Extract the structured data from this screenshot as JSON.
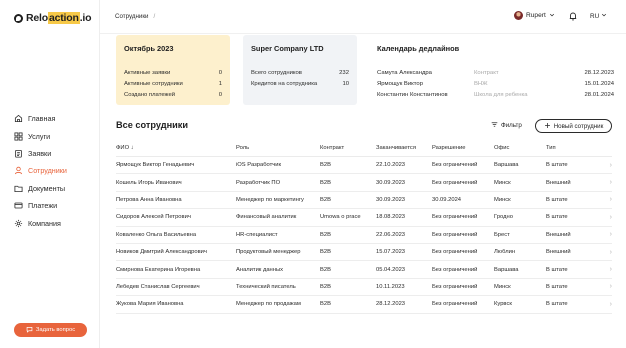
{
  "app": {
    "logo_prefix": "Relo",
    "logo_highlight": "action",
    "logo_suffix": ".io"
  },
  "sidebar": {
    "items": [
      {
        "label": "Главная",
        "icon": "home-icon",
        "active": false
      },
      {
        "label": "Услуги",
        "icon": "grid-icon",
        "active": false
      },
      {
        "label": "Заявки",
        "icon": "clipboard-icon",
        "active": false
      },
      {
        "label": "Сотрудники",
        "icon": "user-icon",
        "active": true
      },
      {
        "label": "Документы",
        "icon": "folder-icon",
        "active": false
      },
      {
        "label": "Платежи",
        "icon": "card-icon",
        "active": false
      },
      {
        "label": "Компания",
        "icon": "gear-icon",
        "active": false
      }
    ],
    "ask_button": "Задать вопрос"
  },
  "topbar": {
    "breadcrumb": "Сотрудники",
    "breadcrumb_sep": "/",
    "user_name": "Rupert",
    "lang": "RU"
  },
  "cards": {
    "month": {
      "title": "Октябрь 2023",
      "rows": [
        {
          "label": "Активные заявки",
          "value": "0"
        },
        {
          "label": "Активные сотрудники",
          "value": "1"
        },
        {
          "label": "Создано платежей",
          "value": "0"
        }
      ]
    },
    "company": {
      "title": "Super Company LTD",
      "rows": [
        {
          "label": "Всего сотрудников",
          "value": "232"
        },
        {
          "label": "Кредитов на сотрудника",
          "value": "10"
        }
      ]
    },
    "deadlines": {
      "title": "Календарь дедлайнов",
      "rows": [
        {
          "name": "Самута Александра",
          "contract": "Контракт",
          "date": "28.12.2023"
        },
        {
          "name": "Ярмощук Виктор",
          "contract": "ВНЖ",
          "date": "15.01.2024"
        },
        {
          "name": "Константин Константинов",
          "contract": "Школа для ребенка",
          "date": "28.01.2024"
        }
      ]
    }
  },
  "employees": {
    "title": "Все сотрудники",
    "filter_label": "Фильтр",
    "new_button": "Новый сотрудник",
    "columns": [
      "ФИО",
      "Роль",
      "Контракт",
      "Заканчивается",
      "Разрешение",
      "Офис",
      "Тип"
    ],
    "sort_arrow": "↓",
    "rows": [
      [
        "Ярмощук Виктор Генадьевич",
        "iOS Разработчик",
        "B2B",
        "22.10.2023",
        "Без ограничений",
        "Варшава",
        "В штате"
      ],
      [
        "Кошель Игорь Иванович",
        "Разработчик ПО",
        "B2B",
        "30.09.2023",
        "Без ограничений",
        "Минск",
        "Внешний"
      ],
      [
        "Петрова Анна Ивановна",
        "Менеджер по маркетингу",
        "B2B",
        "30.09.2023",
        "30.09.2024",
        "Минск",
        "В штате"
      ],
      [
        "Сидоров Алексей Петрович",
        "Финансовый аналитик",
        "Umowa o prace",
        "18.08.2023",
        "Без ограничений",
        "Гродно",
        "В штате"
      ],
      [
        "Коваленко Ольга Васильевна",
        "HR-специалист",
        "B2B",
        "22.06.2023",
        "Без ограничений",
        "Брест",
        "Внешний"
      ],
      [
        "Новиков Дмитрий Александрович",
        "Продуктовый менеджер",
        "B2B",
        "15.07.2023",
        "Без ограничений",
        "Люблин",
        "Внешний"
      ],
      [
        "Смирнова Екатерина Игоревна",
        "Аналитик данных",
        "B2B",
        "05.04.2023",
        "Без ограничений",
        "Варшава",
        "В штате"
      ],
      [
        "Лебедев Станислав Сергеевич",
        "Технический писатель",
        "B2B",
        "10.11.2023",
        "Без ограничений",
        "Минск",
        "В штате"
      ],
      [
        "Жукова Мария Ивановна",
        "Менеджер по продажам",
        "B2B",
        "28.12.2023",
        "Без ограничений",
        "Курвск",
        "В штате"
      ]
    ]
  },
  "colors": {
    "accent": "#e8643c",
    "card_month_bg": "#fdf0cd",
    "card_company_bg": "#f1f3f6",
    "logo_highlight": "#f7c948"
  }
}
